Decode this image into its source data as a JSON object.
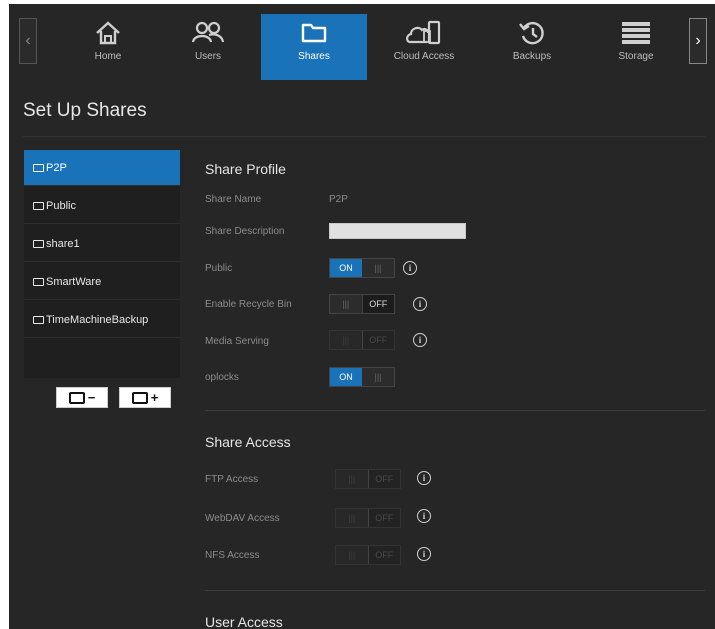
{
  "nav": {
    "prev_arrow": "‹",
    "next_arrow": "›",
    "items": [
      {
        "label": "Home",
        "icon": "home-icon"
      },
      {
        "label": "Users",
        "icon": "users-icon"
      },
      {
        "label": "Shares",
        "icon": "folder-icon",
        "active": true
      },
      {
        "label": "Cloud Access",
        "icon": "cloud-devices-icon"
      },
      {
        "label": "Backups",
        "icon": "history-icon"
      },
      {
        "label": "Storage",
        "icon": "storage-icon"
      }
    ]
  },
  "page": {
    "title": "Set Up Shares"
  },
  "shares": {
    "items": [
      {
        "label": "P2P",
        "active": true
      },
      {
        "label": "Public"
      },
      {
        "label": "share1"
      },
      {
        "label": "SmartWare"
      },
      {
        "label": "TimeMachineBackup"
      }
    ],
    "remove_button": "−",
    "add_button": "+"
  },
  "profile": {
    "title": "Share Profile",
    "share_name_label": "Share Name",
    "share_name_value": "P2P",
    "share_description_label": "Share Description",
    "share_description_value": "",
    "public_label": "Public",
    "recycle_label": "Enable Recycle Bin",
    "media_label": "Media Serving",
    "oplocks_label": "oplocks"
  },
  "toggles": {
    "on": "ON",
    "off": "OFF",
    "grip": "|||"
  },
  "access": {
    "title": "Share Access",
    "ftp_label": "FTP Access",
    "webdav_label": "WebDAV Access",
    "nfs_label": "NFS Access"
  },
  "user_access": {
    "title": "User Access"
  },
  "info_glyph": "i",
  "colors": {
    "accent": "#1a73b8",
    "background": "#262626"
  }
}
